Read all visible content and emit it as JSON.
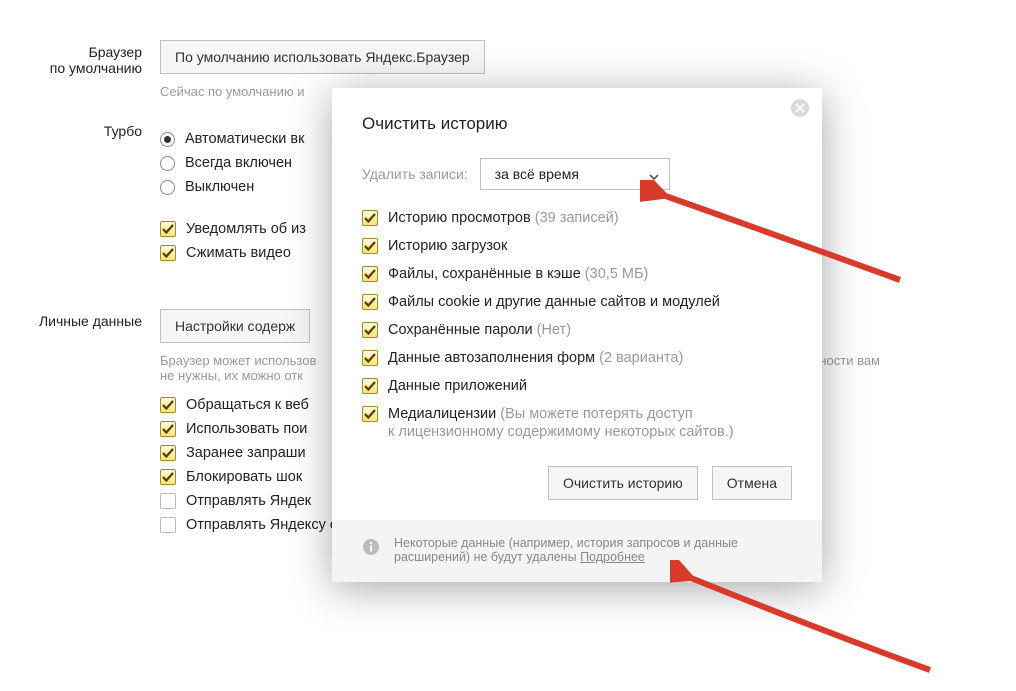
{
  "settings": {
    "default_browser": {
      "label": "Браузер\nпо умолчанию",
      "button": "По умолчанию использовать Яндекс.Браузер",
      "hint": "Сейчас по умолчанию и"
    },
    "turbo": {
      "label": "Турбо",
      "radios": [
        {
          "label": "Автоматически вк",
          "checked": true
        },
        {
          "label": "Всегда включен",
          "checked": false
        },
        {
          "label": "Выключен",
          "checked": false
        }
      ],
      "checks": [
        {
          "label": "Уведомлять об из",
          "checked": true
        },
        {
          "label": "Сжимать видео",
          "checked": true
        }
      ]
    },
    "personal": {
      "label": "Личные данные",
      "button": "Настройки содерж",
      "hint": "Браузер может использов\nне нужны, их можно отк",
      "hint_tail": "ожности вам",
      "checks": [
        {
          "label": "Обращаться к веб",
          "checked": true
        },
        {
          "label": "Использовать пои",
          "checked": true
        },
        {
          "label": "Заранее запраши",
          "checked": true
        },
        {
          "label": "Блокировать шок",
          "checked": true
        },
        {
          "label": "Отправлять Яндек",
          "checked": false
        },
        {
          "label": "Отправлять Яндексу отчеты о сбоях",
          "checked": false
        }
      ]
    }
  },
  "modal": {
    "title": "Очистить историю",
    "range_label": "Удалить записи:",
    "range_value": "за всё время",
    "items": [
      {
        "label": "Историю просмотров",
        "detail": "(39 записей)",
        "checked": true
      },
      {
        "label": "Историю загрузок",
        "detail": "",
        "checked": true
      },
      {
        "label": "Файлы, сохранённые в кэше",
        "detail": "(30,5 МБ)",
        "checked": true
      },
      {
        "label": "Файлы cookie и другие данные сайтов и модулей",
        "detail": "",
        "checked": true
      },
      {
        "label": "Сохранённые пароли",
        "detail": "(Нет)",
        "checked": true
      },
      {
        "label": "Данные автозаполнения форм",
        "detail": "(2 варианта)",
        "checked": true
      },
      {
        "label": "Данные приложений",
        "detail": "",
        "checked": true
      },
      {
        "label": "Медиалицензии",
        "detail": "(Вы можете потерять доступ",
        "sub": "к лицензионному содержимому некоторых сайтов.)",
        "checked": true
      }
    ],
    "actions": {
      "primary": "Очистить историю",
      "cancel": "Отмена"
    },
    "footer": {
      "text": "Некоторые данные (например, история запросов и данные расширений) не будут удалены",
      "link": "Подробнее"
    }
  }
}
